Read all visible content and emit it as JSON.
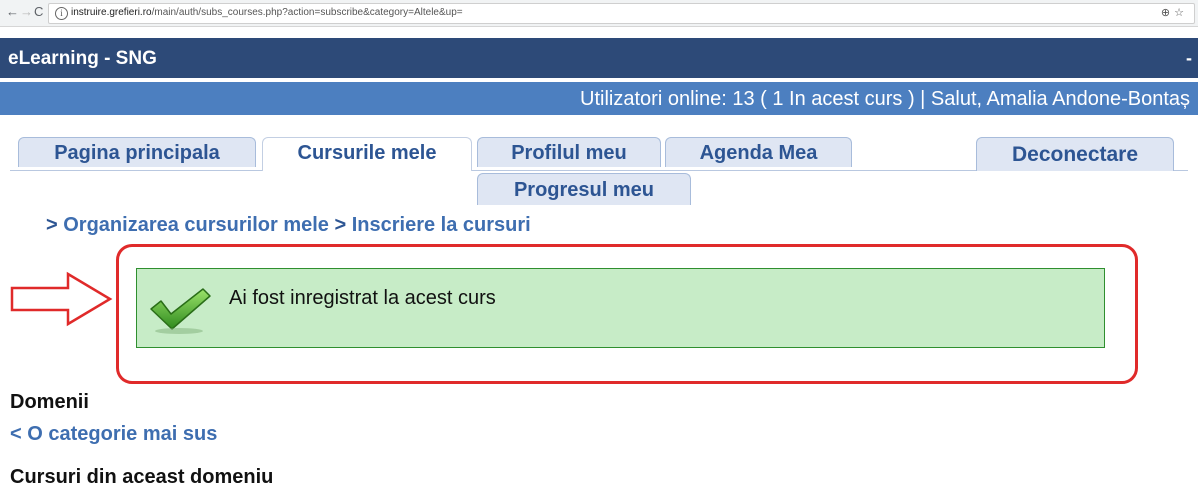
{
  "browser": {
    "back": "←",
    "forward": "→",
    "reload": "C",
    "info": "i",
    "url_host": "instruire.grefieri.ro",
    "url_path": "/main/auth/subs_courses.php?action=subscribe&category=Altele&up=",
    "zoom_icon": "⊕",
    "star_icon": "☆"
  },
  "header": {
    "title": "eLearning - SNG",
    "dash": "-",
    "users_online": "Utilizatori online:  13  ( 1 In acest curs  ) | Salut, Amalia Andone-Bontaș"
  },
  "tabs": [
    {
      "label": "Pagina principala"
    },
    {
      "label": "Cursurile mele"
    },
    {
      "label": "Profilul meu"
    },
    {
      "label": "Agenda Mea"
    },
    {
      "label": "Progresul meu"
    },
    {
      "label": "Deconectare"
    }
  ],
  "breadcrumb": {
    "sep1": "> ",
    "item1": "Organizarea cursurilor mele",
    "sep2": " > ",
    "item2": "Inscriere la cursuri"
  },
  "message": {
    "text": "Ai fost inregistrat la acest curs",
    "icon": "check-icon"
  },
  "content": {
    "domains_heading": "Domenii",
    "up_link": "< O categorie mai sus",
    "courses_heading": "Cursuri din aceast domeniu"
  },
  "colors": {
    "header_bg": "#2d4a78",
    "userbar_bg": "#4c7fc0",
    "link": "#3e6eb0",
    "success_bg": "#c7ecc7",
    "highlight": "#e02a2a"
  }
}
